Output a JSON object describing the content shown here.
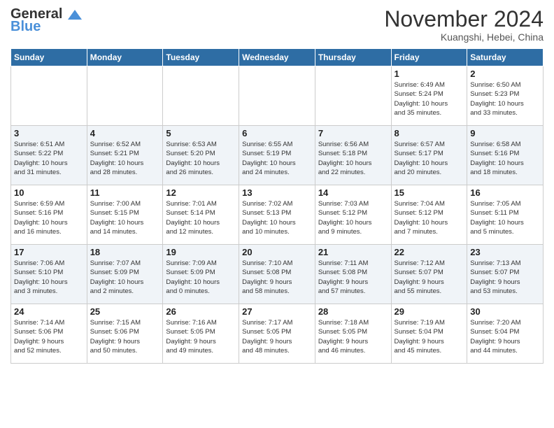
{
  "header": {
    "logo_line1": "General",
    "logo_line2": "Blue",
    "month": "November 2024",
    "location": "Kuangshi, Hebei, China"
  },
  "weekdays": [
    "Sunday",
    "Monday",
    "Tuesday",
    "Wednesday",
    "Thursday",
    "Friday",
    "Saturday"
  ],
  "weeks": [
    [
      {
        "day": "",
        "info": ""
      },
      {
        "day": "",
        "info": ""
      },
      {
        "day": "",
        "info": ""
      },
      {
        "day": "",
        "info": ""
      },
      {
        "day": "",
        "info": ""
      },
      {
        "day": "1",
        "info": "Sunrise: 6:49 AM\nSunset: 5:24 PM\nDaylight: 10 hours\nand 35 minutes."
      },
      {
        "day": "2",
        "info": "Sunrise: 6:50 AM\nSunset: 5:23 PM\nDaylight: 10 hours\nand 33 minutes."
      }
    ],
    [
      {
        "day": "3",
        "info": "Sunrise: 6:51 AM\nSunset: 5:22 PM\nDaylight: 10 hours\nand 31 minutes."
      },
      {
        "day": "4",
        "info": "Sunrise: 6:52 AM\nSunset: 5:21 PM\nDaylight: 10 hours\nand 28 minutes."
      },
      {
        "day": "5",
        "info": "Sunrise: 6:53 AM\nSunset: 5:20 PM\nDaylight: 10 hours\nand 26 minutes."
      },
      {
        "day": "6",
        "info": "Sunrise: 6:55 AM\nSunset: 5:19 PM\nDaylight: 10 hours\nand 24 minutes."
      },
      {
        "day": "7",
        "info": "Sunrise: 6:56 AM\nSunset: 5:18 PM\nDaylight: 10 hours\nand 22 minutes."
      },
      {
        "day": "8",
        "info": "Sunrise: 6:57 AM\nSunset: 5:17 PM\nDaylight: 10 hours\nand 20 minutes."
      },
      {
        "day": "9",
        "info": "Sunrise: 6:58 AM\nSunset: 5:16 PM\nDaylight: 10 hours\nand 18 minutes."
      }
    ],
    [
      {
        "day": "10",
        "info": "Sunrise: 6:59 AM\nSunset: 5:16 PM\nDaylight: 10 hours\nand 16 minutes."
      },
      {
        "day": "11",
        "info": "Sunrise: 7:00 AM\nSunset: 5:15 PM\nDaylight: 10 hours\nand 14 minutes."
      },
      {
        "day": "12",
        "info": "Sunrise: 7:01 AM\nSunset: 5:14 PM\nDaylight: 10 hours\nand 12 minutes."
      },
      {
        "day": "13",
        "info": "Sunrise: 7:02 AM\nSunset: 5:13 PM\nDaylight: 10 hours\nand 10 minutes."
      },
      {
        "day": "14",
        "info": "Sunrise: 7:03 AM\nSunset: 5:12 PM\nDaylight: 10 hours\nand 9 minutes."
      },
      {
        "day": "15",
        "info": "Sunrise: 7:04 AM\nSunset: 5:12 PM\nDaylight: 10 hours\nand 7 minutes."
      },
      {
        "day": "16",
        "info": "Sunrise: 7:05 AM\nSunset: 5:11 PM\nDaylight: 10 hours\nand 5 minutes."
      }
    ],
    [
      {
        "day": "17",
        "info": "Sunrise: 7:06 AM\nSunset: 5:10 PM\nDaylight: 10 hours\nand 3 minutes."
      },
      {
        "day": "18",
        "info": "Sunrise: 7:07 AM\nSunset: 5:09 PM\nDaylight: 10 hours\nand 2 minutes."
      },
      {
        "day": "19",
        "info": "Sunrise: 7:09 AM\nSunset: 5:09 PM\nDaylight: 10 hours\nand 0 minutes."
      },
      {
        "day": "20",
        "info": "Sunrise: 7:10 AM\nSunset: 5:08 PM\nDaylight: 9 hours\nand 58 minutes."
      },
      {
        "day": "21",
        "info": "Sunrise: 7:11 AM\nSunset: 5:08 PM\nDaylight: 9 hours\nand 57 minutes."
      },
      {
        "day": "22",
        "info": "Sunrise: 7:12 AM\nSunset: 5:07 PM\nDaylight: 9 hours\nand 55 minutes."
      },
      {
        "day": "23",
        "info": "Sunrise: 7:13 AM\nSunset: 5:07 PM\nDaylight: 9 hours\nand 53 minutes."
      }
    ],
    [
      {
        "day": "24",
        "info": "Sunrise: 7:14 AM\nSunset: 5:06 PM\nDaylight: 9 hours\nand 52 minutes."
      },
      {
        "day": "25",
        "info": "Sunrise: 7:15 AM\nSunset: 5:06 PM\nDaylight: 9 hours\nand 50 minutes."
      },
      {
        "day": "26",
        "info": "Sunrise: 7:16 AM\nSunset: 5:05 PM\nDaylight: 9 hours\nand 49 minutes."
      },
      {
        "day": "27",
        "info": "Sunrise: 7:17 AM\nSunset: 5:05 PM\nDaylight: 9 hours\nand 48 minutes."
      },
      {
        "day": "28",
        "info": "Sunrise: 7:18 AM\nSunset: 5:05 PM\nDaylight: 9 hours\nand 46 minutes."
      },
      {
        "day": "29",
        "info": "Sunrise: 7:19 AM\nSunset: 5:04 PM\nDaylight: 9 hours\nand 45 minutes."
      },
      {
        "day": "30",
        "info": "Sunrise: 7:20 AM\nSunset: 5:04 PM\nDaylight: 9 hours\nand 44 minutes."
      }
    ]
  ]
}
